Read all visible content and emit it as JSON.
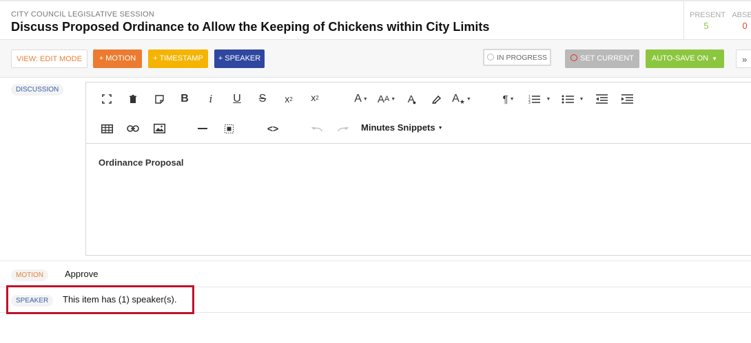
{
  "header": {
    "supertitle": "CITY COUNCIL LEGISLATIVE SESSION",
    "title": "Discuss Proposed Ordinance to Allow the Keeping of Chickens within City Limits",
    "stats": {
      "present_label": "PRESENT",
      "present_value": "5",
      "absent_label": "ABSEN",
      "absent_value": "0"
    }
  },
  "toolbar": {
    "view_mode": "VIEW: EDIT MODE",
    "motion": "+ MOTION",
    "timestamp": "+ TIMESTAMP",
    "speaker": "+ SPEAKER",
    "in_progress": "IN PROGRESS",
    "set_current": "SET CURRENT",
    "auto_save": "AUTO-SAVE ON",
    "more": "»"
  },
  "discussion": {
    "label": "DISCUSSION",
    "content": "Ordinance Proposal",
    "snippets_label": "Minutes Snippets",
    "toolbar_icons": [
      "fullscreen-icon",
      "trash-icon",
      "note-icon",
      "bold-icon",
      "italic-icon",
      "underline-icon",
      "strikethrough-icon",
      "subscript-icon",
      "superscript-icon",
      "font-family-icon",
      "font-size-icon",
      "text-color-icon",
      "highlight-icon",
      "text-style-icon",
      "paragraph-icon",
      "ordered-list-icon",
      "unordered-list-icon",
      "outdent-icon",
      "indent-icon",
      "table-icon",
      "link-icon",
      "image-icon",
      "horizontal-line-icon",
      "select-all-icon",
      "code-view-icon",
      "undo-icon",
      "redo-icon"
    ]
  },
  "motion": {
    "label": "MOTION",
    "text": "Approve"
  },
  "speaker": {
    "label": "SPEAKER",
    "text": "This item has (1) speaker(s)."
  },
  "colors": {
    "motion_orange": "#ec7b30",
    "timestamp_yellow": "#f4b400",
    "speaker_blue": "#2f47a0",
    "autosave_green": "#8cc63f",
    "highlight_red": "#c0102c"
  }
}
